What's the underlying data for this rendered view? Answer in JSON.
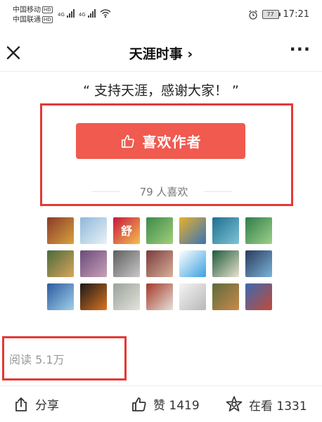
{
  "status_bar": {
    "carrier_1": "中国移动",
    "carrier_2": "中国联通",
    "hd": "HD",
    "net_1": "4G",
    "net_2": "4G",
    "battery": "77",
    "time": "17:21"
  },
  "nav": {
    "title": "天涯时事",
    "chevron": "›",
    "more": "···"
  },
  "content": {
    "thanks_message": "“ 支持天涯，感谢大家！ ”",
    "like_author_label": "喜欢作者",
    "likes_count_text": "79 人喜欢",
    "read_count_text": "阅读 5.1万"
  },
  "avatars": [
    {
      "name": "avatar-1",
      "colors": [
        "#8a3a2a",
        "#d7a33c"
      ],
      "text": ""
    },
    {
      "name": "avatar-2",
      "colors": [
        "#8fb7d9",
        "#e8f1f7"
      ],
      "text": ""
    },
    {
      "name": "avatar-3",
      "colors": [
        "#c9163f",
        "#f2c14e"
      ],
      "text": "舒"
    },
    {
      "name": "avatar-4",
      "colors": [
        "#3d8a4b",
        "#a2cf7a"
      ],
      "text": ""
    },
    {
      "name": "avatar-5",
      "colors": [
        "#e7b12b",
        "#3973b8"
      ],
      "text": ""
    },
    {
      "name": "avatar-6",
      "colors": [
        "#1e6f8f",
        "#7fc3d6"
      ],
      "text": ""
    },
    {
      "name": "avatar-7",
      "colors": [
        "#2f7d4a",
        "#9ed08a"
      ],
      "text": ""
    },
    {
      "name": "avatar-8",
      "colors": [
        "#4a6b3c",
        "#d9a55b"
      ],
      "text": ""
    },
    {
      "name": "avatar-9",
      "colors": [
        "#6b4a7a",
        "#c8a0b8"
      ],
      "text": ""
    },
    {
      "name": "avatar-10",
      "colors": [
        "#5e5e5e",
        "#c9c9c9"
      ],
      "text": ""
    },
    {
      "name": "avatar-11",
      "colors": [
        "#7a3b3b",
        "#d9b09a"
      ],
      "text": ""
    },
    {
      "name": "avatar-12",
      "colors": [
        "#ffffff",
        "#3aa0e0"
      ],
      "text": ""
    },
    {
      "name": "avatar-13",
      "colors": [
        "#1f5a3a",
        "#e8e2d0"
      ],
      "text": ""
    },
    {
      "name": "avatar-14",
      "colors": [
        "#2a3b5c",
        "#7ab3d9"
      ],
      "text": ""
    },
    {
      "name": "avatar-15",
      "colors": [
        "#2d5aa0",
        "#9fd0e8"
      ],
      "text": ""
    },
    {
      "name": "avatar-16",
      "colors": [
        "#1a1a1a",
        "#d9731f"
      ],
      "text": ""
    },
    {
      "name": "avatar-17",
      "colors": [
        "#9aa39a",
        "#e3e3dc"
      ],
      "text": ""
    },
    {
      "name": "avatar-18",
      "colors": [
        "#a33a2a",
        "#e8e0d8"
      ],
      "text": ""
    },
    {
      "name": "avatar-19",
      "colors": [
        "#f4f4f4",
        "#b8b8b8"
      ],
      "text": ""
    },
    {
      "name": "avatar-20",
      "colors": [
        "#5c6b3c",
        "#c98a4a"
      ],
      "text": ""
    },
    {
      "name": "avatar-21",
      "colors": [
        "#3a6ab0",
        "#c24a3a"
      ],
      "text": ""
    }
  ],
  "footer": {
    "share_label": "分享",
    "like_label": "赞 1419",
    "look_label": "在看 1331"
  },
  "colors": {
    "accent": "#f05a4f",
    "annotation_box": "#e53935"
  },
  "icons": [
    "close-icon",
    "thumbs-up-icon",
    "share-icon",
    "star-icon",
    "wifi-icon",
    "alarm-icon"
  ]
}
